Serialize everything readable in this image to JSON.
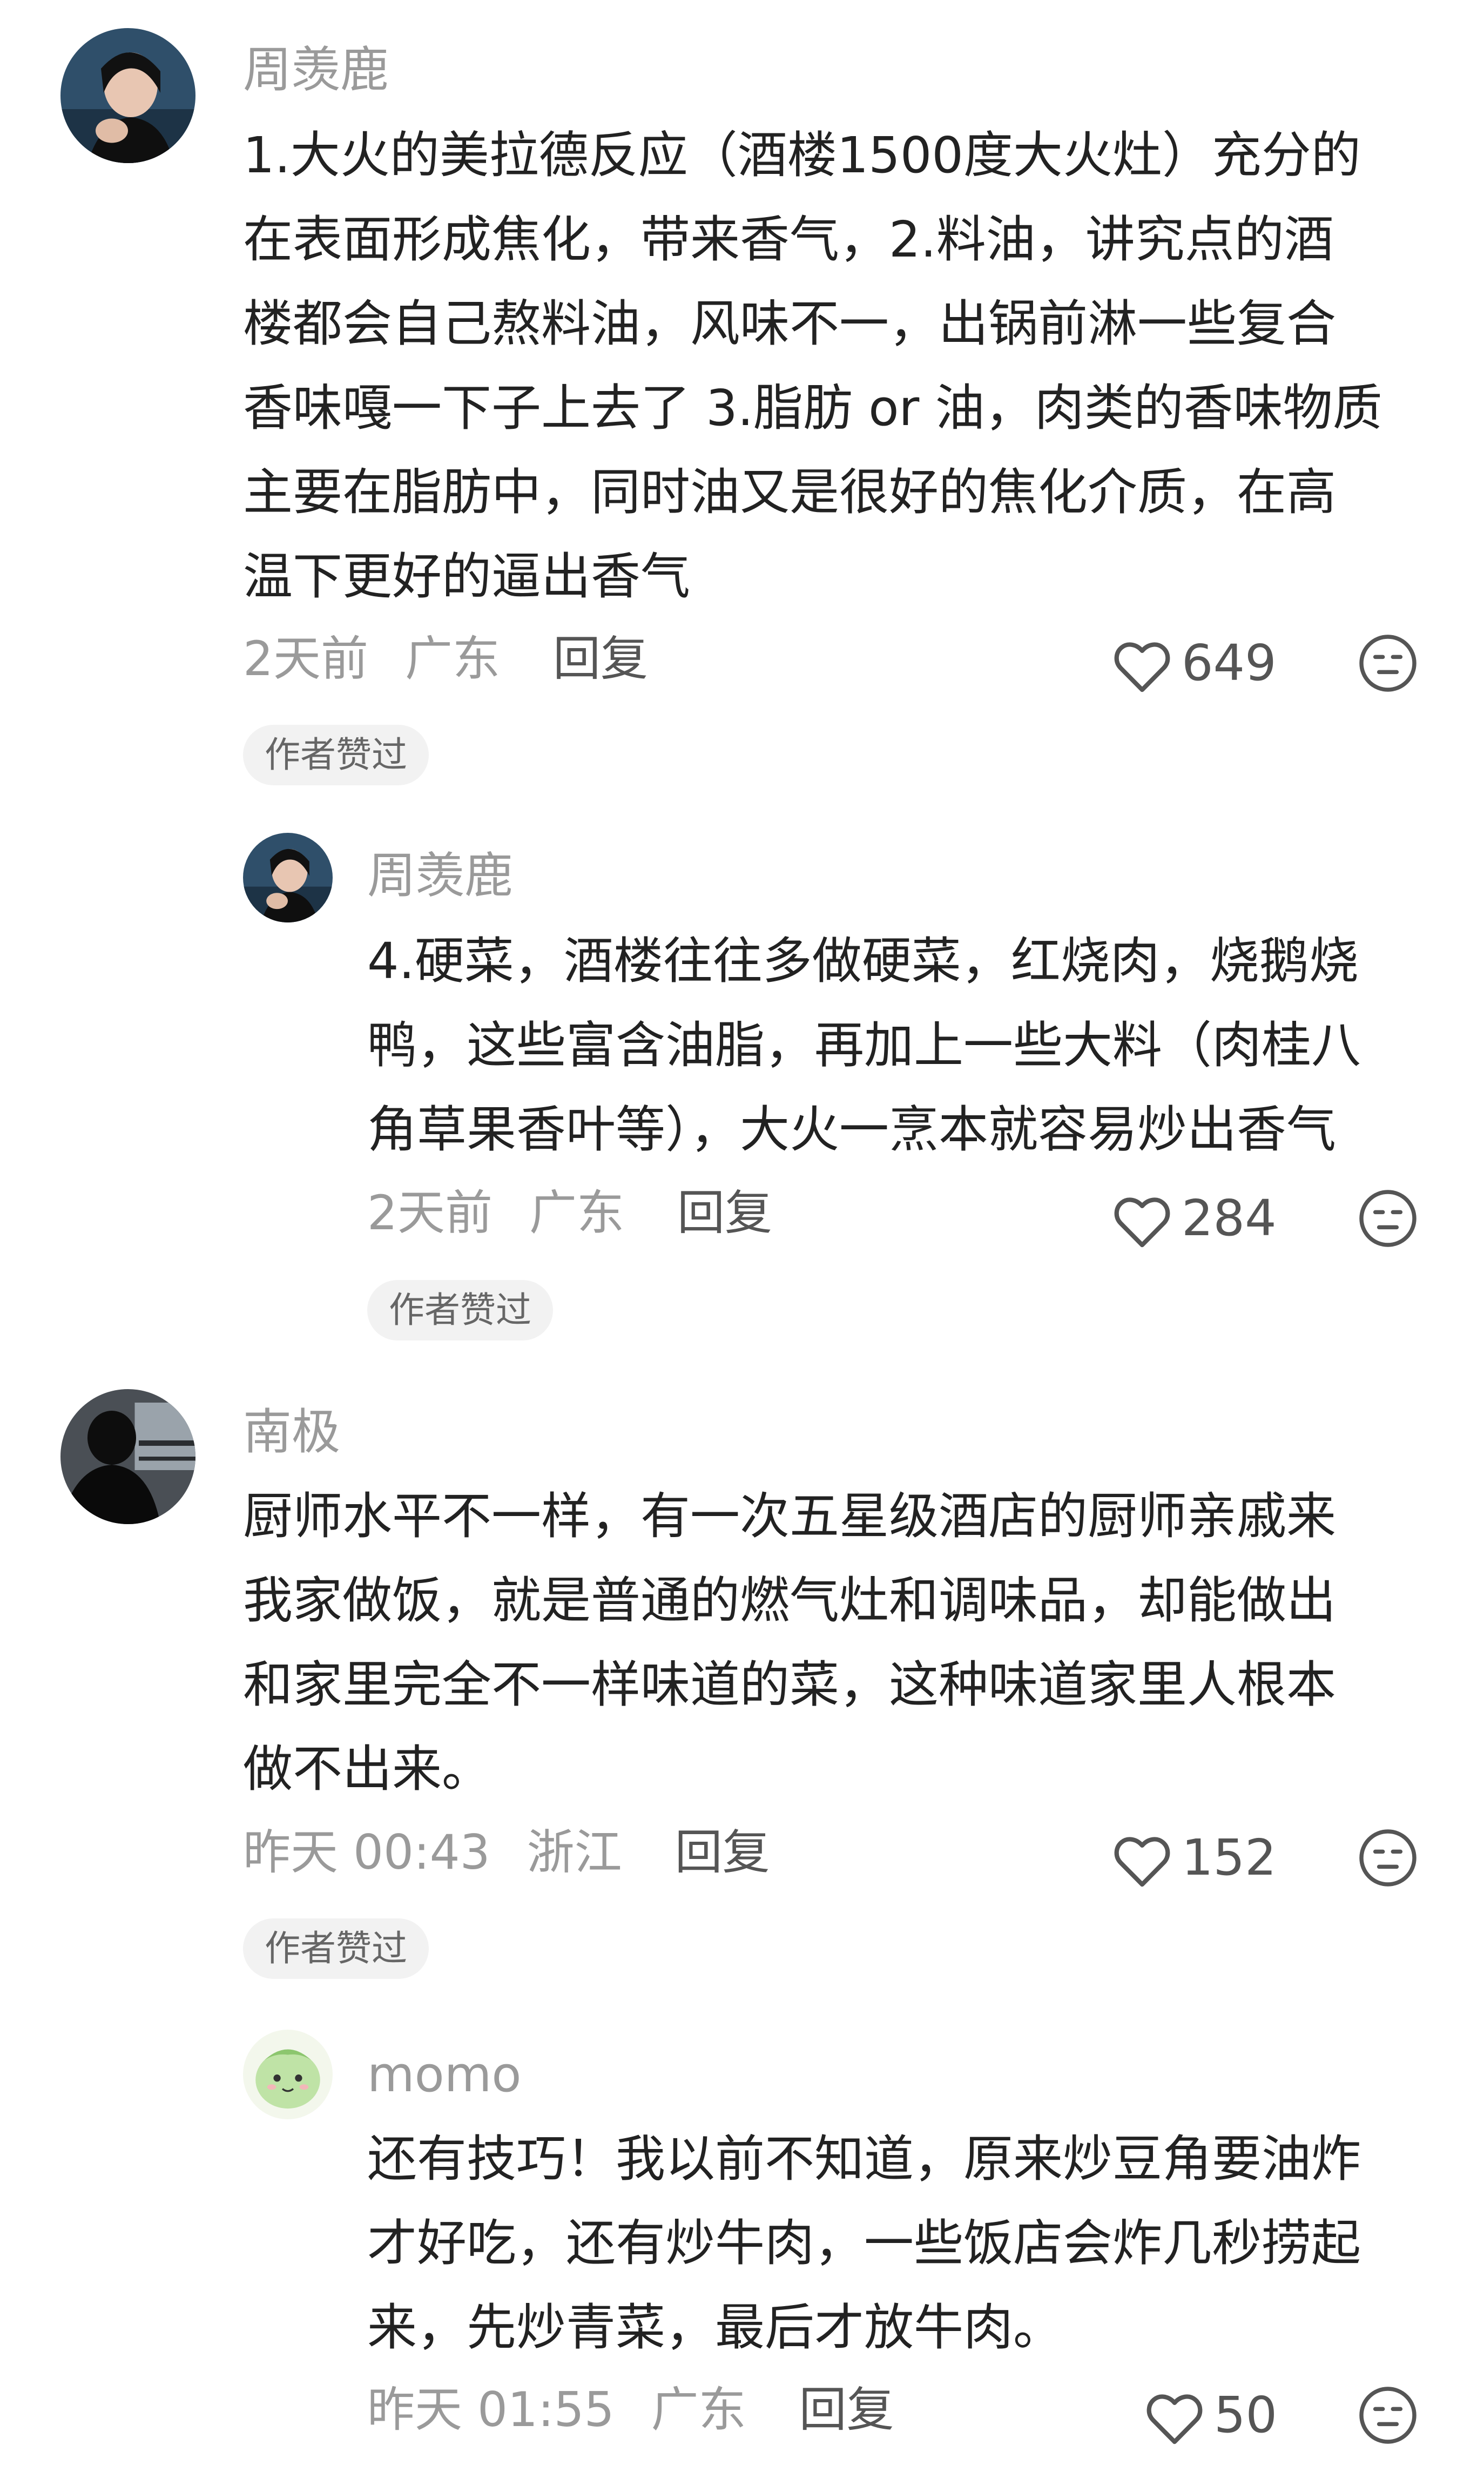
{
  "comments": [
    {
      "username": "周羡鹿",
      "lines": [
        "1.大火的美拉德反应（酒楼1500度大火灶）充分的",
        "在表面形成焦化，带来香气，2.料油，讲究点的酒",
        "楼都会自己熬料油，风味不一，出锅前淋一些复合",
        "香味嘎一下子上去了 3.脂肪 or 油，肉类的香味物质",
        "主要在脂肪中，同时油又是很好的焦化介质，在高",
        "温下更好的逼出香气"
      ],
      "time": "2天前",
      "location": "广东",
      "reply_label": "回复",
      "likes": "649",
      "badge": "作者赞过",
      "avatar_icon": "woman-portrait-avatar"
    },
    {
      "username": "周羡鹿",
      "lines": [
        "4.硬菜，酒楼往往多做硬菜，红烧肉，烧鹅烧",
        "鸭，这些富含油脂，再加上一些大料（肉桂八",
        "角草果香叶等），大火一烹本就容易炒出香气"
      ],
      "time": "2天前",
      "location": "广东",
      "reply_label": "回复",
      "likes": "284",
      "badge": "作者赞过",
      "avatar_icon": "woman-portrait-avatar"
    },
    {
      "username": "南极",
      "lines": [
        "厨师水平不一样，有一次五星级酒店的厨师亲戚来",
        "我家做饭，就是普通的燃气灶和调味品，却能做出",
        "和家里完全不一样味道的菜，这种味道家里人根本",
        "做不出来。"
      ],
      "time": "昨天 00:43",
      "location": "浙江",
      "reply_label": "回复",
      "likes": "152",
      "badge": "作者赞过",
      "avatar_icon": "man-silhouette-avatar"
    },
    {
      "username": "momo",
      "lines": [
        "还有技巧！我以前不知道，原来炒豆角要油炸",
        "才好吃，还有炒牛肉，一些饭店会炸几秒捞起",
        "来，先炒青菜，最后才放牛肉。"
      ],
      "time": "昨天 01:55",
      "location": "广东",
      "reply_label": "回复",
      "likes": "50",
      "badge": "",
      "avatar_icon": "cartoon-character-avatar"
    }
  ],
  "colors": {
    "background": "#ffffff",
    "text": "#222222",
    "secondary_text": "#9a9a9a",
    "badge_bg": "#f2f2f2"
  }
}
